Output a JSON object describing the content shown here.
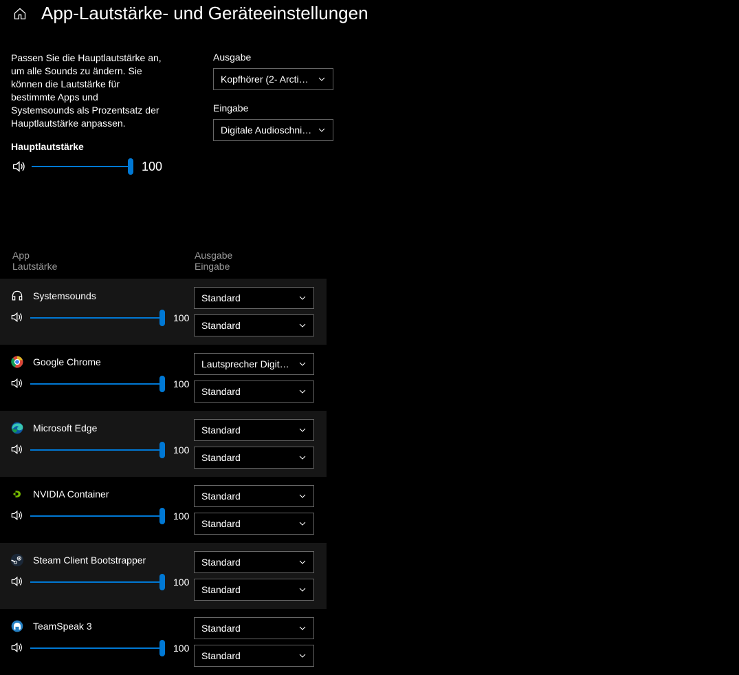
{
  "header": {
    "title": "App-Lautstärke- und Geräteeinstellungen"
  },
  "description": "Passen Sie die Hauptlautstärke an, um alle Sounds zu ändern. Sie können die Lautstärke für bestimmte Apps und Systemsounds als Prozentsatz der Hauptlautstärke anpassen.",
  "master": {
    "label": "Hauptlautstärke",
    "value": 100
  },
  "output": {
    "label": "Ausgabe",
    "selected": "Kopfhörer (2- Arctis…"
  },
  "input": {
    "label": "Eingabe",
    "selected": "Digitale Audioschnit…"
  },
  "columns": {
    "app": "App",
    "volume": "Lautstärke",
    "output": "Ausgabe",
    "input": "Eingabe"
  },
  "defaults": {
    "standard": "Standard"
  },
  "apps": [
    {
      "name": "Systemsounds",
      "icon": "headphones",
      "volume": 100,
      "output": "Standard",
      "input": "Standard",
      "alt": true
    },
    {
      "name": "Google Chrome",
      "icon": "chrome",
      "volume": 100,
      "output": "Lautsprecher Digital (F",
      "input": "Standard",
      "alt": false
    },
    {
      "name": "Microsoft Edge",
      "icon": "edge",
      "volume": 100,
      "output": "Standard",
      "input": "Standard",
      "alt": true
    },
    {
      "name": "NVIDIA Container",
      "icon": "nvidia",
      "volume": 100,
      "output": "Standard",
      "input": "Standard",
      "alt": false
    },
    {
      "name": "Steam Client Bootstrapper",
      "icon": "steam",
      "volume": 100,
      "output": "Standard",
      "input": "Standard",
      "alt": true
    },
    {
      "name": "TeamSpeak 3",
      "icon": "teamspeak",
      "volume": 100,
      "output": "Standard",
      "input": "Standard",
      "alt": false
    }
  ],
  "colors": {
    "accent": "#0078d4"
  }
}
